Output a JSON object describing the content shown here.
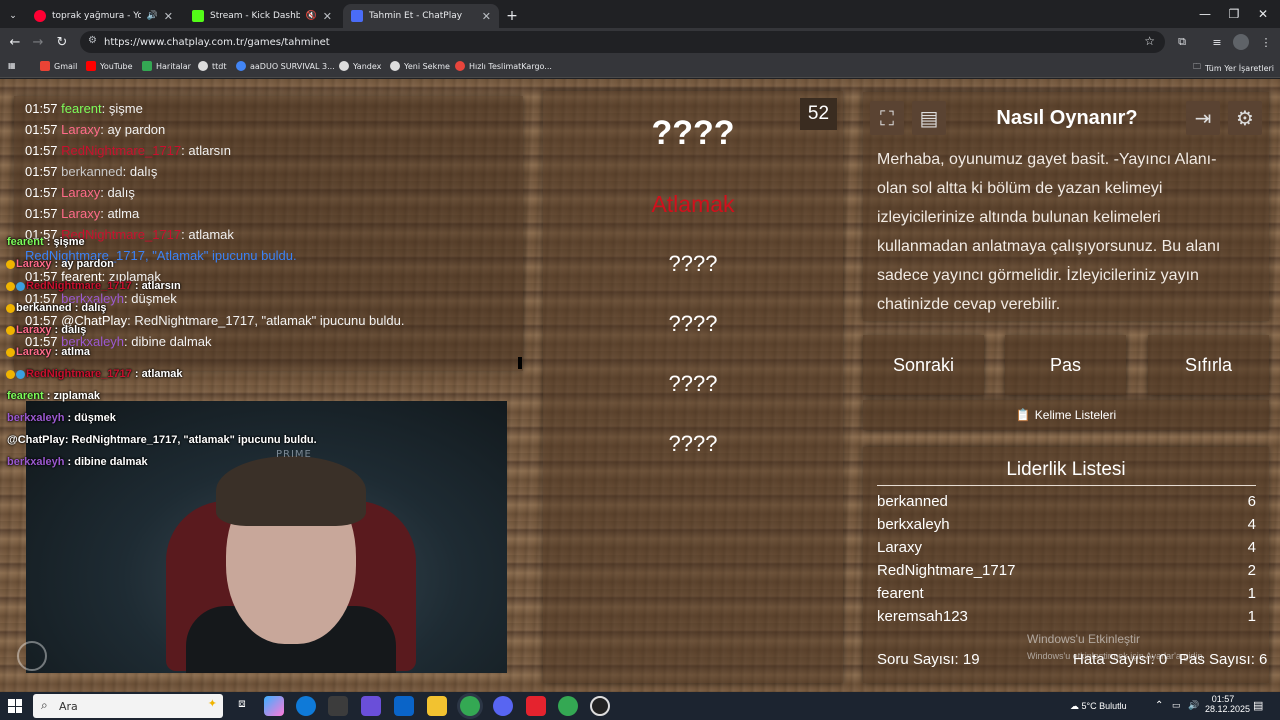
{
  "browser": {
    "tabs": [
      {
        "title": "toprak yağmura - YouTube",
        "color": "#ff0033"
      },
      {
        "title": "Stream - Kick Dashboard",
        "color": "#53fc18"
      },
      {
        "title": "Tahmin Et - ChatPlay",
        "color": "#4a6cf7"
      }
    ],
    "new_tab": "+",
    "url": "https://www.chatplay.com.tr/games/tahminet",
    "bookmarks": [
      {
        "label": "Gmail",
        "color": "#ea4335"
      },
      {
        "label": "YouTube",
        "color": "#ff0000"
      },
      {
        "label": "Haritalar",
        "color": "#34a853"
      },
      {
        "label": "ttdt",
        "color": "#dddddd"
      },
      {
        "label": "aaDUO SURVIVAL 3...",
        "color": "#4285f4"
      },
      {
        "label": "Yandex",
        "color": "#dddddd"
      },
      {
        "label": "Yeni Sekme",
        "color": "#dddddd"
      },
      {
        "label": "Hızlı TeslimatKargo...",
        "color": "#e8453c"
      }
    ],
    "all_bookmarks": "Tüm Yer İşaretleri"
  },
  "chat_log": [
    {
      "time": "01:57",
      "user": "fearent",
      "color": "#7cfc5a",
      "msg": "şişme"
    },
    {
      "time": "01:57",
      "user": "Laraxy",
      "color": "#ff6b8a",
      "msg": "ay pardon"
    },
    {
      "time": "01:57",
      "user": "RedNightmare_1717",
      "color": "#c8102e",
      "msg": "atlarsın"
    },
    {
      "time": "01:57",
      "user": "berkanned",
      "color": "#c9c9c9",
      "msg": "dalış"
    },
    {
      "time": "01:57",
      "user": "Laraxy",
      "color": "#ff6b8a",
      "msg": "dalış"
    },
    {
      "time": "01:57",
      "user": "Laraxy",
      "color": "#ff6b8a",
      "msg": "atlma"
    },
    {
      "time": "01:57",
      "user": "RedNightmare_1717",
      "color": "#c8102e",
      "msg": "atlamak"
    },
    {
      "time": "",
      "user": "RedNightmare_1717, \"Atlamak\" ipucunu buldu.",
      "color": "#3b82f6",
      "msg": ""
    },
    {
      "time": "01:57",
      "user": "fearent",
      "color": "#ffffff",
      "msg": "zıplamak"
    },
    {
      "time": "01:57",
      "user": "berkxaleyh",
      "color": "#9b59d0",
      "msg": "düşmek"
    },
    {
      "time": "01:57",
      "user": "@ChatPlay",
      "color": "#ffffff",
      "msg": "RedNightmare_1717, \"atlamak\" ipucunu buldu."
    },
    {
      "time": "01:57",
      "user": "berkxaleyh",
      "color": "#9b59d0",
      "msg": "dibine dalmak"
    }
  ],
  "overlay_chat": [
    {
      "user": "fearent",
      "color": "#7cfc5a",
      "msg": "şişme"
    },
    {
      "user": "Laraxy",
      "color": "#ff6b8a",
      "msg": "ay pardon"
    },
    {
      "user": "RedNightmare_1717",
      "color": "#c8102e",
      "msg": "atlarsın"
    },
    {
      "user": "berkanned",
      "color": "#ffffff",
      "msg": "dalış"
    },
    {
      "user": "Laraxy",
      "color": "#ff6b8a",
      "msg": "dalış"
    },
    {
      "user": "Laraxy",
      "color": "#ff6b8a",
      "msg": "atlma"
    },
    {
      "user": "RedNightmare_1717",
      "color": "#c8102e",
      "msg": "atlamak"
    },
    {
      "user": "fearent",
      "color": "#7cfc5a",
      "msg": "zıplamak"
    },
    {
      "user": "berkxaleyh",
      "color": "#9b59d0",
      "msg": "düşmek"
    },
    {
      "user": "@ChatPlay",
      "color": "#ffffff",
      "msg": "RedNightmare_1717, \"atlamak\" ipucunu buldu."
    },
    {
      "user": "berkxaleyh",
      "color": "#9b59d0",
      "msg": "dibine dalmak"
    }
  ],
  "webcam_text": "PRIME",
  "game": {
    "counter": "52",
    "target_word": "????",
    "found_word": "Atlamak",
    "hidden_words": [
      "????",
      "????",
      "????",
      "????"
    ]
  },
  "how_to": {
    "title": "Nasıl Oynanır?",
    "text": "Merhaba, oyunumuz gayet basit. -Yayıncı Alanı- olan sol altta ki bölüm de yazan kelimeyi izleyicilerinize altında bulunan kelimeleri kullanmadan anlatmaya çalışıyorsunuz. Bu alanı sadece yayıncı görmelidir. İzleyicileriniz yayın chatinizde cevap verebilir."
  },
  "buttons": {
    "next": "Sonraki",
    "pass": "Pas",
    "reset": "Sıfırla",
    "word_lists": "Kelime Listeleri"
  },
  "leaderboard": {
    "title": "Liderlik Listesi",
    "rows": [
      {
        "name": "berkanned",
        "score": "6"
      },
      {
        "name": "berkxaleyh",
        "score": "4"
      },
      {
        "name": "Laraxy",
        "score": "4"
      },
      {
        "name": "RedNightmare_1717",
        "score": "2"
      },
      {
        "name": "fearent",
        "score": "1"
      },
      {
        "name": "keremsah123",
        "score": "1"
      }
    ]
  },
  "stats": {
    "questions": "Soru Sayısı: 19",
    "errors": "Hata Sayısı: 0",
    "passes": "Pas Sayısı: 6"
  },
  "windows_activation": {
    "title": "Windows'u Etkinleştir",
    "sub": "Windows'u etkinleştirmek için Ayarlar'a gidin."
  },
  "taskbar": {
    "search_placeholder": "Ara",
    "weather": "5°C Bulutlu",
    "time": "01:57",
    "date": "28.12.2025"
  }
}
